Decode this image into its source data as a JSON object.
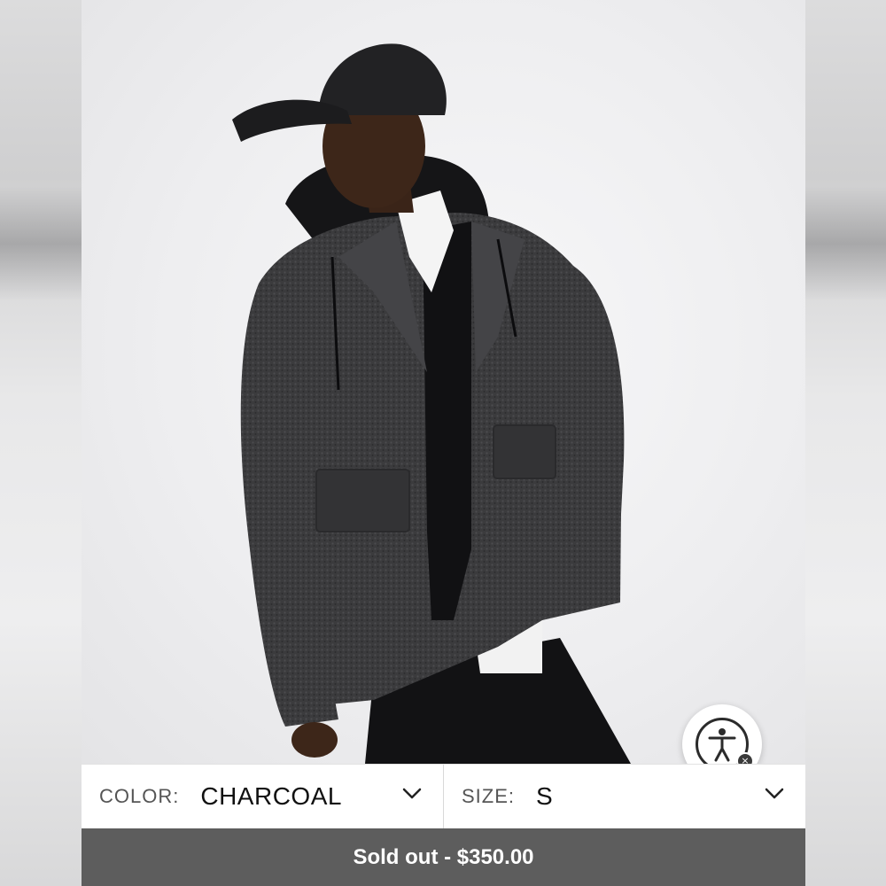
{
  "product": {
    "image_alt": "Model wearing charcoal boucle wool jacket with black hoodie and cap"
  },
  "color": {
    "label": "COLOR:",
    "value": "CHARCOAL"
  },
  "size": {
    "label": "SIZE:",
    "value": "S"
  },
  "purchase": {
    "status": "Sold out",
    "separator": " - ",
    "price": "$350.00"
  },
  "accessibility_widget": {
    "icon": "accessibility-person-icon",
    "close_icon": "close-icon",
    "close_glyph": "×"
  },
  "colors": {
    "buy_bar": "#5d5d5d",
    "jacket": "#3a3a3c",
    "background": "#eeeef0"
  }
}
